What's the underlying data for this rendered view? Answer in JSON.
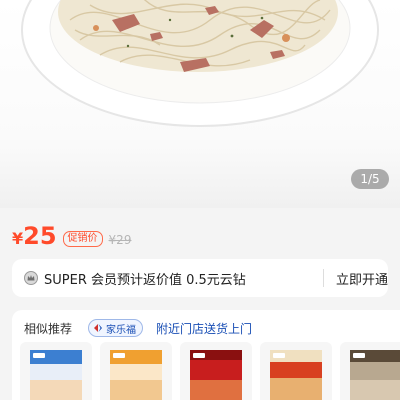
{
  "gallery": {
    "image_label": "pasta-dish-photo",
    "counter": "1/5"
  },
  "price": {
    "currency": "¥",
    "amount": "25",
    "promo_tag": "促销价",
    "original": "¥29",
    "color": "#ff4a2a"
  },
  "membership": {
    "text": "SUPER 会员预计返价值 0.5元云钻",
    "action": "立即开通"
  },
  "similar": {
    "title": "相似推荐",
    "brand": "家乐福",
    "store_link": "附近门店送货上门",
    "items": [
      {
        "name": "noodle-pack-1",
        "color": "#3c7fd1"
      },
      {
        "name": "noodle-pack-2",
        "color": "#f0a030"
      },
      {
        "name": "noodle-pack-3",
        "color": "#c81e1e"
      },
      {
        "name": "noodle-pack-4",
        "color": "#d84020"
      },
      {
        "name": "noodle-pack-5",
        "color": "#b8a890"
      }
    ]
  }
}
